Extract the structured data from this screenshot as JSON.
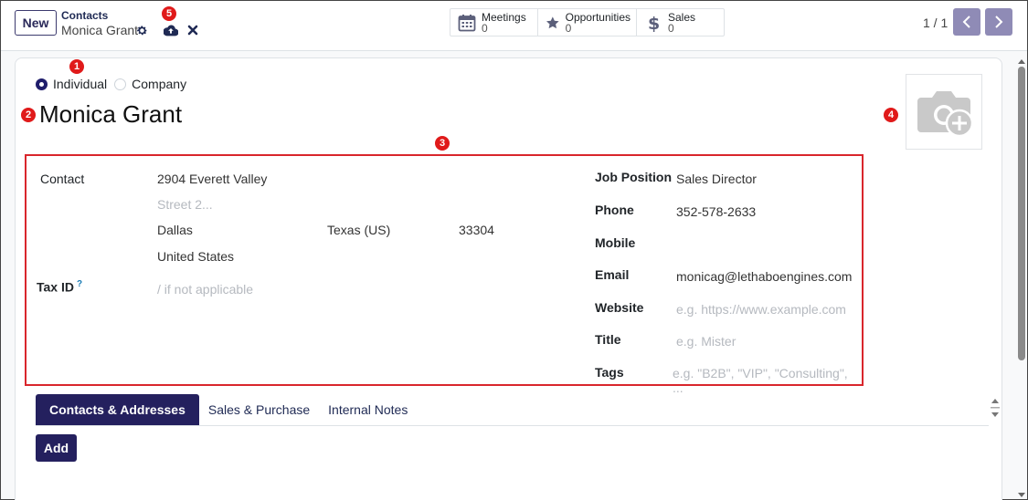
{
  "toolbar": {
    "new_label": "New",
    "breadcrumb_parent": "Contacts",
    "breadcrumb_current": "Monica Grant"
  },
  "smart_buttons": [
    {
      "label": "Meetings",
      "value": "0",
      "icon": "calendar-icon"
    },
    {
      "label": "Opportunities",
      "value": "0",
      "icon": "star-icon"
    },
    {
      "label": "Sales",
      "value": "0",
      "icon": "dollar-icon"
    }
  ],
  "pager": {
    "text": "1 / 1"
  },
  "form": {
    "company_type": {
      "options": [
        "Individual",
        "Company"
      ],
      "selected": "Individual"
    },
    "name": "Monica Grant",
    "left": {
      "contact_label": "Contact",
      "street": "2904 Everett Valley",
      "street2_placeholder": "Street 2...",
      "city": "Dallas",
      "state": "Texas (US)",
      "zip": "33304",
      "country": "United States",
      "tax_id_label": "Tax ID",
      "tax_id_help": "?",
      "tax_id_placeholder": "/ if not applicable"
    },
    "right": {
      "job_position_label": "Job Position",
      "job_position": "Sales Director",
      "phone_label": "Phone",
      "phone": "352-578-2633",
      "mobile_label": "Mobile",
      "mobile": "",
      "email_label": "Email",
      "email": "monicag@lethaboengines.com",
      "website_label": "Website",
      "website_placeholder": "e.g. https://www.example.com",
      "title_label": "Title",
      "title_placeholder": "e.g. Mister",
      "tags_label": "Tags",
      "tags_placeholder": "e.g. \"B2B\", \"VIP\", \"Consulting\", ..."
    }
  },
  "notebook": {
    "tabs": [
      "Contacts & Addresses",
      "Sales & Purchase",
      "Internal Notes"
    ],
    "active_tab": "Contacts & Addresses",
    "add_label": "Add"
  },
  "annotations": [
    "1",
    "2",
    "3",
    "4",
    "5"
  ],
  "colors": {
    "primary": "#24205e",
    "pager": "#8f8bb6",
    "annotation": "#e01a1a"
  }
}
